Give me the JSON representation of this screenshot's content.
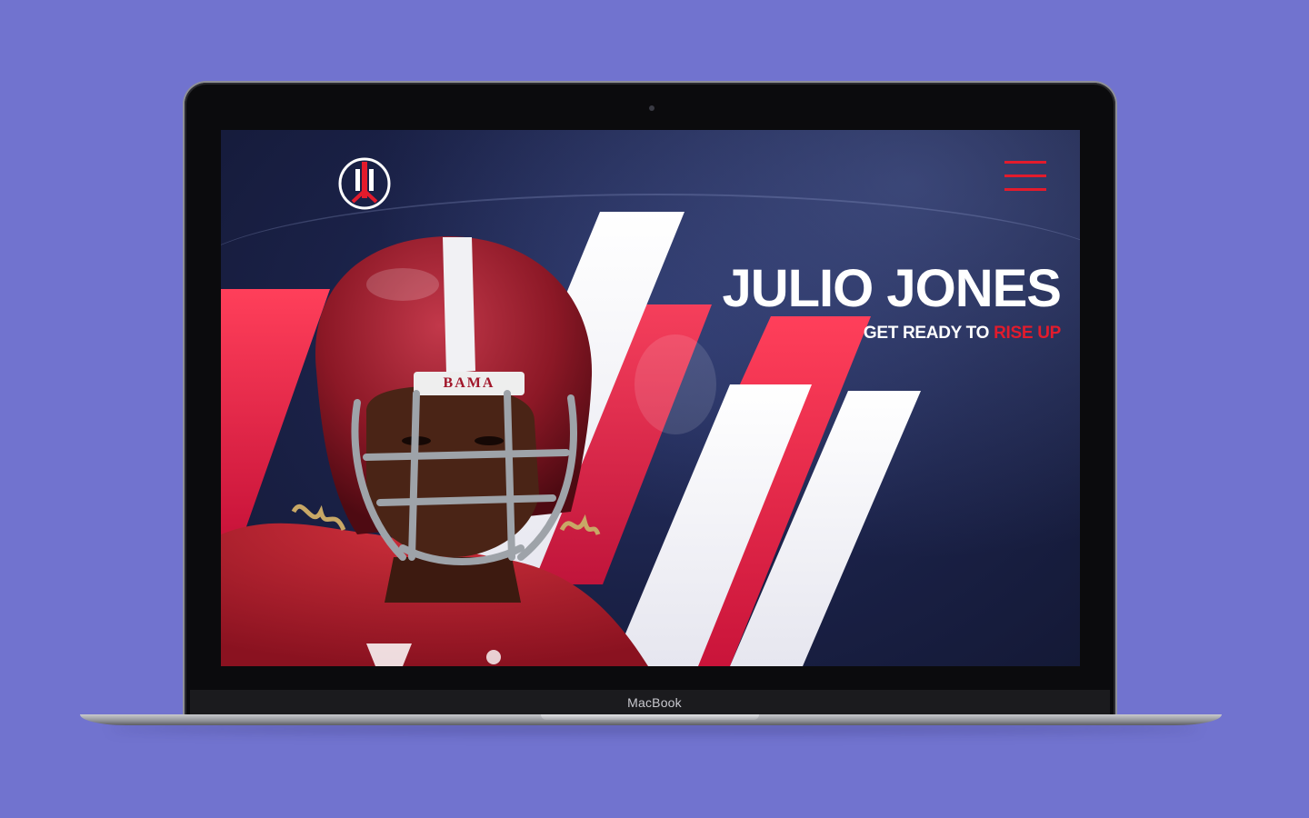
{
  "device": {
    "brand_label": "MacBook"
  },
  "site": {
    "logo_icon": "jersey-number-11-logo-icon",
    "menu_icon": "hamburger-menu-icon",
    "hero": {
      "title": "JULIO JONES",
      "subtitle_prefix": "GET READY TO",
      "subtitle_accent": "RISE UP"
    },
    "photo": {
      "helmet_label": "BAMA"
    }
  },
  "colors": {
    "background": "#7173cf",
    "accent_red": "#e31b2c",
    "navy": "#1a2147",
    "white": "#ffffff"
  }
}
